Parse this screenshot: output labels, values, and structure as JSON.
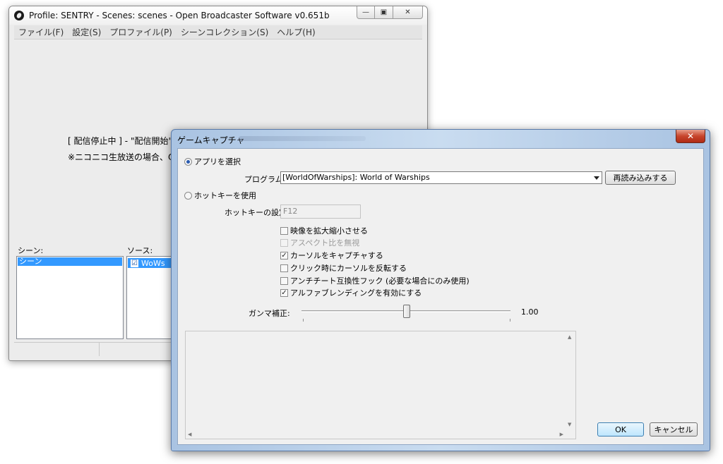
{
  "main_window": {
    "title": "Profile: SENTRY - Scenes: scenes - Open Broadcaster Software v0.651b",
    "caption": {
      "min": "—",
      "max": "▣",
      "close": "✕"
    },
    "menu": [
      "ファイル(F)",
      "設定(S)",
      "プロファイル(P)",
      "シーンコレクション(S)",
      "ヘルプ(H)"
    ],
    "status_text": "[ 配信停止中 ] - \"配信開始\"、",
    "note_text": "※ニコニコ生放送の場合、OBSの",
    "scenes_label": "シーン:",
    "sources_label": "ソース:",
    "scenes": [
      "シーン"
    ],
    "sources": [
      {
        "name": "WoWs",
        "checked": "☑"
      }
    ]
  },
  "dialog": {
    "title": "ゲームキャプチャ",
    "close": "✕",
    "radio_app": "アプリを選択",
    "program_label": "プログラム:",
    "program_value": "[WorldOfWarships]: World of Warships",
    "reload_button": "再読み込みする",
    "radio_hotkey": "ホットキーを使用",
    "hotkey_label": "ホットキーの設定",
    "hotkey_value": "F12",
    "checkboxes": [
      {
        "label": "映像を拡大縮小させる",
        "mark": "",
        "enabled": true
      },
      {
        "label": "アスペクト比を無視",
        "mark": "",
        "enabled": false
      },
      {
        "label": "カーソルをキャプチャする",
        "mark": "✓",
        "enabled": true
      },
      {
        "label": "クリック時にカーソルを反転する",
        "mark": "",
        "enabled": true
      },
      {
        "label": "アンチチート互換性フック (必要な場合にのみ使用)",
        "mark": "",
        "enabled": true
      },
      {
        "label": "アルファブレンディングを有効にする",
        "mark": "✓",
        "enabled": true
      }
    ],
    "gamma_label": "ガンマ補正:",
    "gamma_value": "1.00",
    "gamma_slider": {
      "min": 0,
      "max": 2,
      "value": 1.0
    },
    "ok_button": "OK",
    "cancel_button": "キャンセル"
  }
}
